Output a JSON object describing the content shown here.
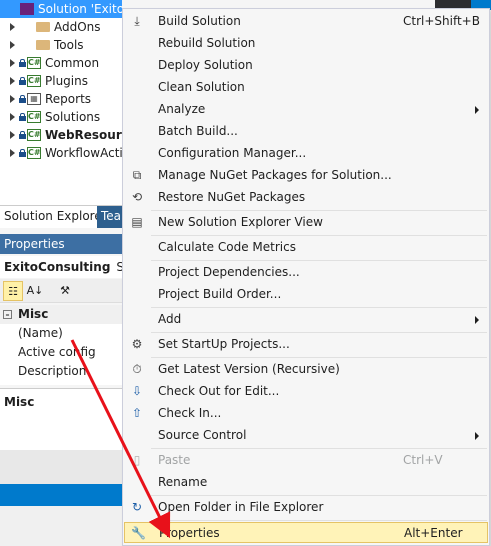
{
  "solution_explorer": {
    "solution_label": "Solution 'ExitoCo",
    "items": [
      {
        "label": "AddOns",
        "kind": "folder"
      },
      {
        "label": "Tools",
        "kind": "folder"
      },
      {
        "label": "Common",
        "kind": "project"
      },
      {
        "label": "Plugins",
        "kind": "project"
      },
      {
        "label": "Reports",
        "kind": "project"
      },
      {
        "label": "Solutions",
        "kind": "project"
      },
      {
        "label": "WebResourc",
        "kind": "project",
        "bold": true
      },
      {
        "label": "WorkflowActi",
        "kind": "project"
      }
    ],
    "tabs": [
      "Solution Explorer",
      "Tea"
    ]
  },
  "properties": {
    "title": "Properties",
    "object_name": "ExitoConsulting",
    "object_type": "Soluti",
    "category": "Misc",
    "rows": [
      "(Name)",
      "Active config",
      "Description"
    ],
    "description_title": "Misc"
  },
  "context_menu": {
    "items": [
      {
        "label": "Build Solution",
        "shortcut": "Ctrl+Shift+B",
        "icon": "build-icon"
      },
      {
        "label": "Rebuild Solution"
      },
      {
        "label": "Deploy Solution"
      },
      {
        "label": "Clean Solution"
      },
      {
        "label": "Analyze",
        "submenu": true
      },
      {
        "label": "Batch Build..."
      },
      {
        "label": "Configuration Manager..."
      },
      {
        "label": "Manage NuGet Packages for Solution...",
        "icon": "nuget-icon"
      },
      {
        "label": "Restore NuGet Packages",
        "icon": "restore-icon"
      },
      {
        "label": "New Solution Explorer View",
        "icon": "new-view-icon"
      },
      {
        "label": "Calculate Code Metrics"
      },
      {
        "label": "Project Dependencies..."
      },
      {
        "label": "Project Build Order..."
      },
      {
        "label": "Add",
        "submenu": true
      },
      {
        "label": "Set StartUp Projects...",
        "icon": "gear-icon"
      },
      {
        "label": "Get Latest Version (Recursive)",
        "icon": "get-latest-icon"
      },
      {
        "label": "Check Out for Edit...",
        "icon": "check-out-icon"
      },
      {
        "label": "Check In...",
        "icon": "check-in-icon"
      },
      {
        "label": "Source Control",
        "submenu": true
      },
      {
        "label": "Paste",
        "shortcut": "Ctrl+V",
        "disabled": true,
        "icon": "paste-icon"
      },
      {
        "label": "Rename"
      },
      {
        "label": "Open Folder in File Explorer",
        "icon": "open-folder-icon"
      },
      {
        "label": "Properties",
        "shortcut": "Alt+Enter",
        "icon": "wrench-icon",
        "highlighted": true
      }
    ]
  },
  "colors": {
    "highlight": "#fff3b8",
    "arrow": "#e8111a",
    "accent": "#007acc"
  }
}
